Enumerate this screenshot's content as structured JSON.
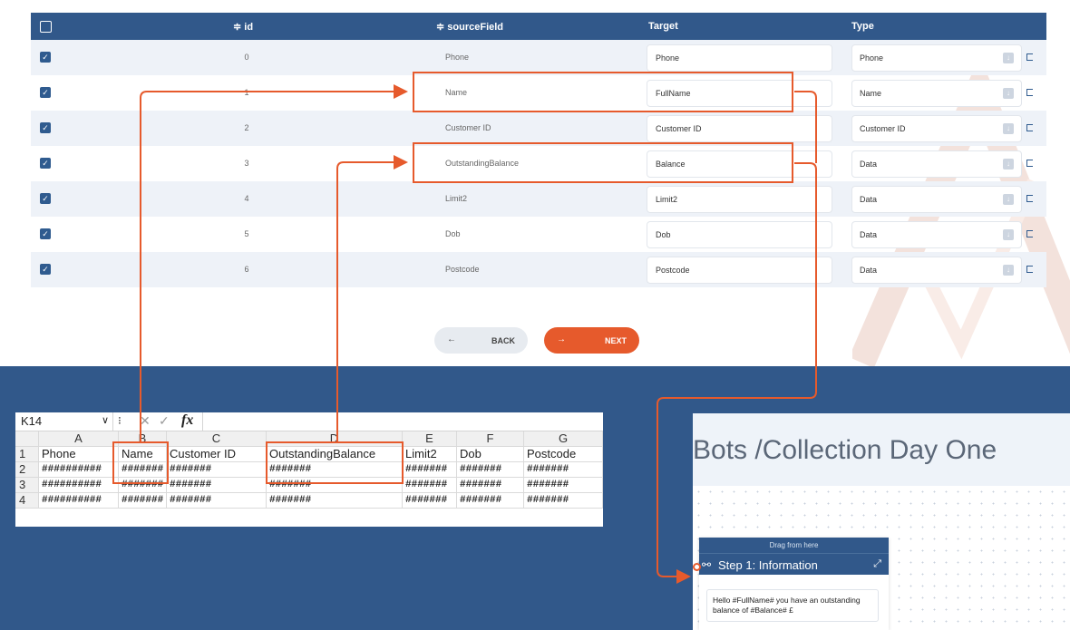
{
  "colors": {
    "header": "#31588a",
    "accent": "#e65a2c",
    "background_band": "#31588a"
  },
  "mapping_table": {
    "headers": {
      "id": "≑ id",
      "source": "≑ sourceField",
      "target": "Target",
      "type": "Type"
    },
    "rows": [
      {
        "id": "0",
        "source": "Phone",
        "target": "Phone",
        "type": "Phone"
      },
      {
        "id": "1",
        "source": "Name",
        "target": "FullName",
        "type": "Name"
      },
      {
        "id": "2",
        "source": "Customer ID",
        "target": "Customer ID",
        "type": "Customer ID"
      },
      {
        "id": "3",
        "source": "OutstandingBalance",
        "target": "Balance",
        "type": "Data"
      },
      {
        "id": "4",
        "source": "Limit2",
        "target": "Limit2",
        "type": "Data"
      },
      {
        "id": "5",
        "source": "Dob",
        "target": "Dob",
        "type": "Data"
      },
      {
        "id": "6",
        "source": "Postcode",
        "target": "Postcode",
        "type": "Data"
      }
    ],
    "back_label": "BACK",
    "next_label": "NEXT",
    "back_arrow": "←",
    "next_arrow": "→"
  },
  "excel": {
    "name_box": "K14",
    "dots": "⁝",
    "cancel_glyph": "✕",
    "enter_glyph": "✓",
    "fx_label": "fx",
    "columns": [
      "A",
      "B",
      "C",
      "D",
      "E",
      "F",
      "G"
    ],
    "rows": [
      {
        "num": "1",
        "cells": [
          "Phone",
          "Name",
          "Customer ID",
          "OutstandingBalance",
          "Limit2",
          "Dob",
          "Postcode"
        ]
      },
      {
        "num": "2",
        "cells": [
          "##########",
          "#######",
          "#######",
          "#######",
          "#######",
          "#######",
          "#######"
        ]
      },
      {
        "num": "3",
        "cells": [
          "##########",
          "#######",
          "#######",
          "#######",
          "#######",
          "#######",
          "#######"
        ]
      },
      {
        "num": "4",
        "cells": [
          "##########",
          "#######",
          "#######",
          "#######",
          "#######",
          "#######",
          "#######"
        ]
      }
    ]
  },
  "bots": {
    "title": "Bots /Collection Day One",
    "drag_label": "Drag from here",
    "step_title": "Step 1: Information",
    "message": "Hello #FullName# you have an outstanding balance of #Balance# £"
  }
}
